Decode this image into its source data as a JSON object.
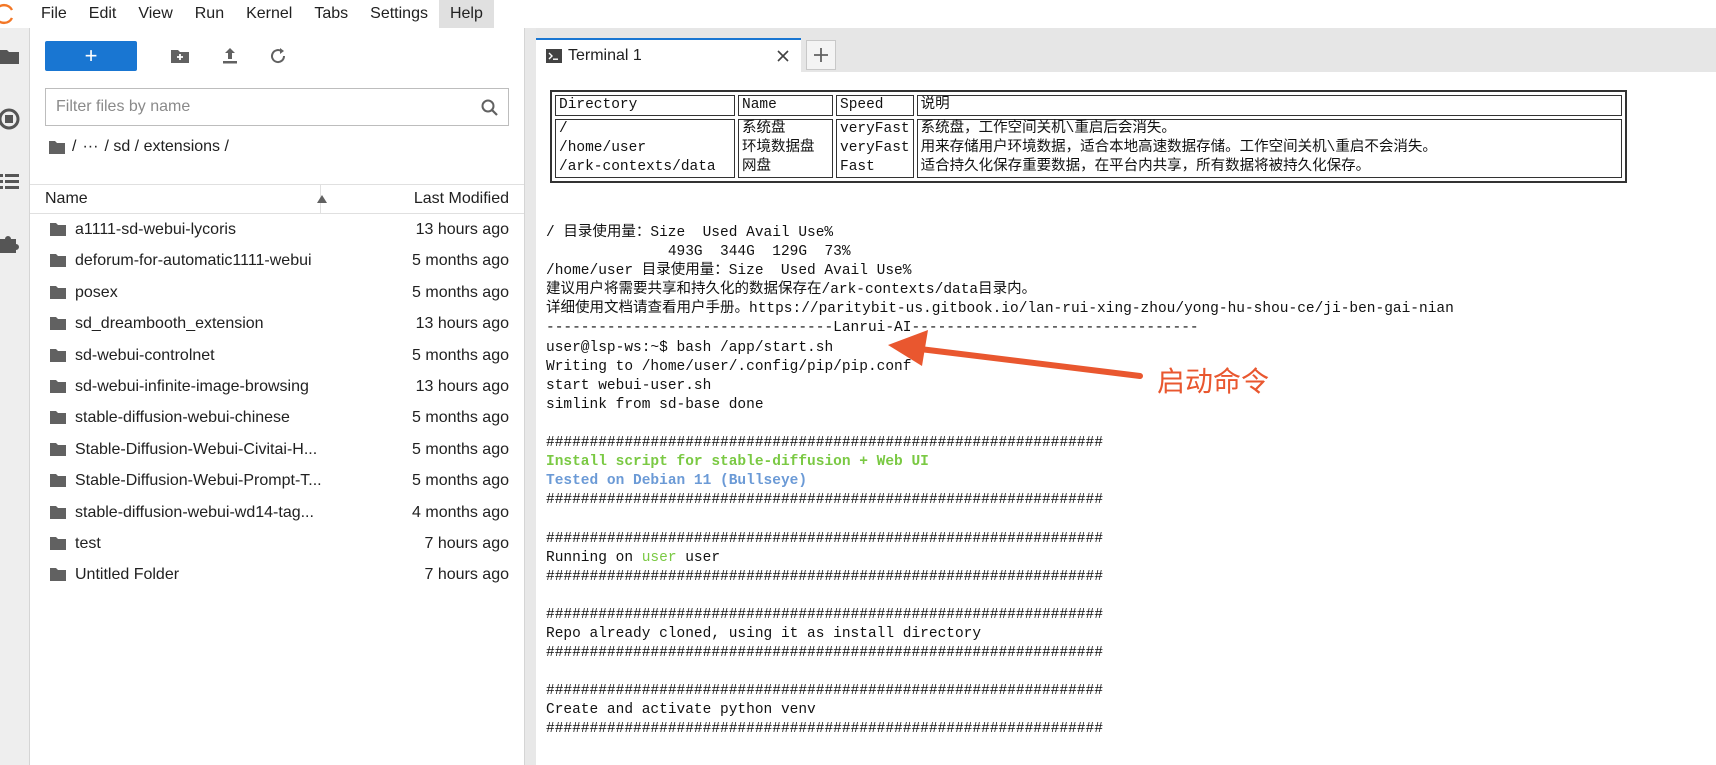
{
  "menu": {
    "items": [
      "File",
      "Edit",
      "View",
      "Run",
      "Kernel",
      "Tabs",
      "Settings",
      "Help"
    ],
    "active": "Help"
  },
  "filebrowser": {
    "new_label": "+",
    "filter_placeholder": "Filter files by name",
    "breadcrumb": [
      "/",
      "···",
      "/ sd / extensions /"
    ],
    "columns": {
      "name": "Name",
      "modified": "Last Modified"
    },
    "files": [
      {
        "name": "a1111-sd-webui-lycoris",
        "modified": "13 hours ago"
      },
      {
        "name": "deforum-for-automatic1111-webui",
        "modified": "5 months ago"
      },
      {
        "name": "posex",
        "modified": "5 months ago"
      },
      {
        "name": "sd_dreambooth_extension",
        "modified": "13 hours ago"
      },
      {
        "name": "sd-webui-controlnet",
        "modified": "5 months ago"
      },
      {
        "name": "sd-webui-infinite-image-browsing",
        "modified": "13 hours ago"
      },
      {
        "name": "stable-diffusion-webui-chinese",
        "modified": "5 months ago"
      },
      {
        "name": "Stable-Diffusion-Webui-Civitai-H...",
        "modified": "5 months ago"
      },
      {
        "name": "Stable-Diffusion-Webui-Prompt-T...",
        "modified": "5 months ago"
      },
      {
        "name": "stable-diffusion-webui-wd14-tag...",
        "modified": "4 months ago"
      },
      {
        "name": "test",
        "modified": "7 hours ago"
      },
      {
        "name": "Untitled Folder",
        "modified": "7 hours ago"
      }
    ]
  },
  "tab": {
    "label": "Terminal 1",
    "add_label": "+"
  },
  "terminal": {
    "table_header": [
      "Directory",
      "Name",
      "Speed",
      "说明"
    ],
    "table_rows": [
      [
        "/",
        "系统盘",
        "veryFast",
        "系统盘，工作空间关机\\重启后会消失。"
      ],
      [
        "/home/user",
        "环境数据盘",
        "veryFast",
        "用来存储用户环境数据，适合本地高速数据存储。工作空间关机\\重启不会消失。"
      ],
      [
        "/ark-contexts/data",
        "网盘",
        "Fast",
        "适合持久化保存重要数据，在平台内共享，所有数据将被持久化保存。"
      ]
    ],
    "lines": [
      "/ 目录使用量：Size  Used Avail Use%",
      "              493G  344G  129G  73%",
      "/home/user 目录使用量：Size  Used Avail Use%",
      "建议用户将需要共享和持久化的数据保存在/ark-contexts/data目录内。",
      "详细使用文档请查看用户手册。https://paritybit-us.gitbook.io/lan-rui-xing-zhou/yong-hu-shou-ce/ji-ben-gai-nian",
      "---------------------------------Lanrui-AI---------------------------------",
      "user@lsp-ws:~$ bash /app/start.sh",
      "Writing to /home/user/.config/pip/pip.conf",
      "start webui-user.sh",
      "simlink from sd-base done",
      "",
      "################################################################",
      "Install script for stable-diffusion + Web UI",
      "Tested on Debian 11 (Bullseye)",
      "################################################################",
      "",
      "################################################################",
      "Running on ",
      "################################################################",
      "",
      "################################################################",
      "Repo already cloned, using it as install directory",
      "################################################################",
      "",
      "################################################################",
      "Create and activate python venv",
      "################################################################",
      "",
      "----------------------------------------------------------------"
    ],
    "running_user": "user",
    "running_suffix": " user"
  },
  "annotation": {
    "text": "启动命令",
    "color": "#e9572f"
  },
  "colors": {
    "accent": "#1976d2",
    "green": "#7ac943",
    "blue": "#6b9ad6"
  }
}
